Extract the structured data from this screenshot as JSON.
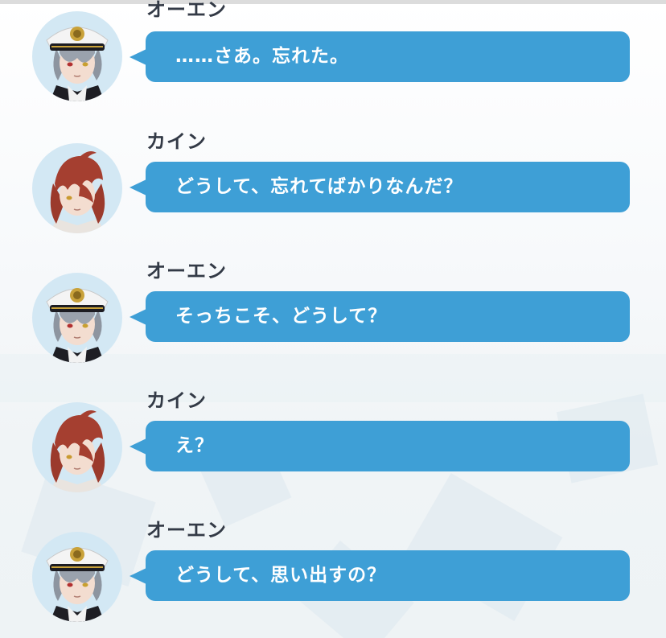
{
  "dialogue": [
    {
      "speaker": "オーエン",
      "character": "owen",
      "text": "……さあ。忘れた。"
    },
    {
      "speaker": "カイン",
      "character": "cain",
      "text": "どうして、忘れてばかりなんだ？"
    },
    {
      "speaker": "オーエン",
      "character": "owen",
      "text": "そっちこそ、どうして？"
    },
    {
      "speaker": "カイン",
      "character": "cain",
      "text": "え？"
    },
    {
      "speaker": "オーエン",
      "character": "owen",
      "text": "どうして、思い出すの？"
    }
  ],
  "colors": {
    "bubble": "#3e9fd6",
    "speaker_text": "#333a46",
    "bubble_text": "#ffffff",
    "avatar_bg": "#d3e8f4"
  }
}
